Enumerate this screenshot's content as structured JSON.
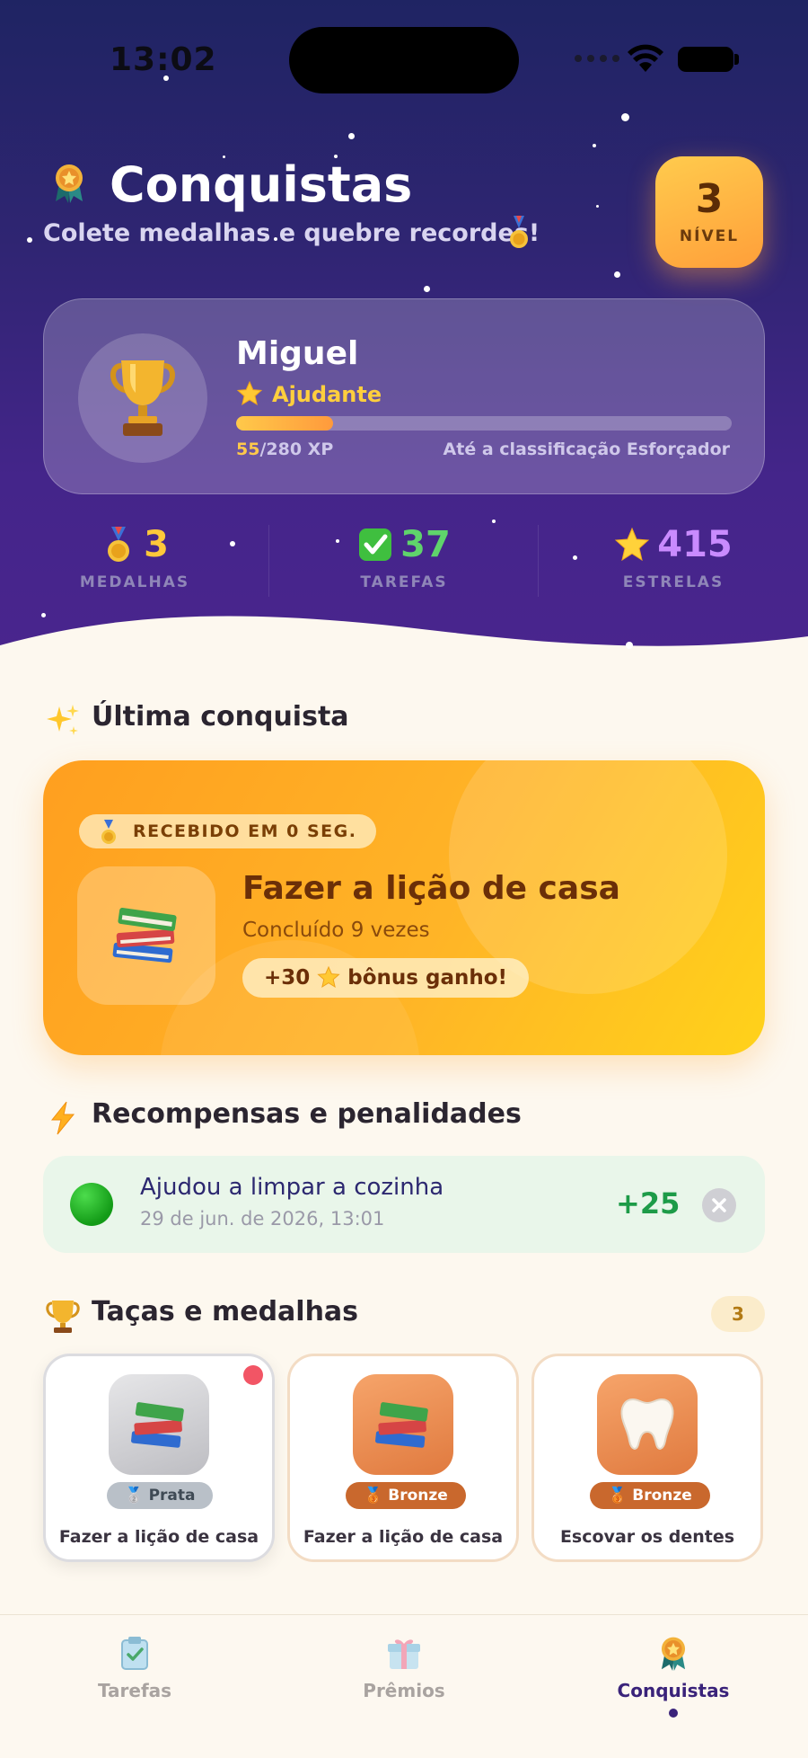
{
  "status_bar": {
    "time": "13:02"
  },
  "header": {
    "title": "Conquistas",
    "subtitle": "Colete medalhas e quebre recordes!",
    "level_number": "3",
    "level_label": "NÍVEL"
  },
  "profile": {
    "name": "Miguel",
    "rank": "Ajudante",
    "xp_current": "55",
    "xp_total": "/280 XP",
    "xp_progress": 0.196,
    "next_rank_text": "Até a classificação Esforçador"
  },
  "stats": [
    {
      "icon": "medal-icon",
      "value": "3",
      "label": "MEDALHAS",
      "color": "#ffc83a"
    },
    {
      "icon": "check-icon",
      "value": "37",
      "label": "TAREFAS",
      "color": "#5fd46b"
    },
    {
      "icon": "star-icon",
      "value": "415",
      "label": "ESTRELAS",
      "color": "#c98bff"
    }
  ],
  "last_achievement": {
    "section_title": "Última conquista",
    "received": "RECEBIDO EM 0 SEG.",
    "title": "Fazer a lição de casa",
    "subtitle": "Concluído 9 vezes",
    "bonus_prefix": "+30",
    "bonus_suffix": "bônus ganho!"
  },
  "rewards": {
    "section_title": "Recompensas e penalidades",
    "items": [
      {
        "name": "Ajudou a limpar a cozinha",
        "date": "29 de jun. de 2026, 13:01",
        "points": "+25"
      }
    ]
  },
  "trophies": {
    "section_title": "Taças e medalhas",
    "count": "3",
    "items": [
      {
        "tier": "Prata",
        "name": "Fazer a lição de casa",
        "icon": "books-icon",
        "is_new": true
      },
      {
        "tier": "Bronze",
        "name": "Fazer a lição de casa",
        "icon": "books-icon",
        "is_new": false
      },
      {
        "tier": "Bronze",
        "name": "Escovar os dentes",
        "icon": "tooth-icon",
        "is_new": false
      }
    ]
  },
  "tabbar": {
    "tabs": [
      {
        "label": "Tarefas",
        "icon": "clipboard-icon",
        "active": false
      },
      {
        "label": "Prêmios",
        "icon": "gift-icon",
        "active": false
      },
      {
        "label": "Conquistas",
        "icon": "medal-icon",
        "active": true
      }
    ]
  },
  "colors": {
    "accent": "#3a237a",
    "header_bg": "#2f2572",
    "card_orange": "#ffb427",
    "reward_green": "#1d9b48"
  }
}
